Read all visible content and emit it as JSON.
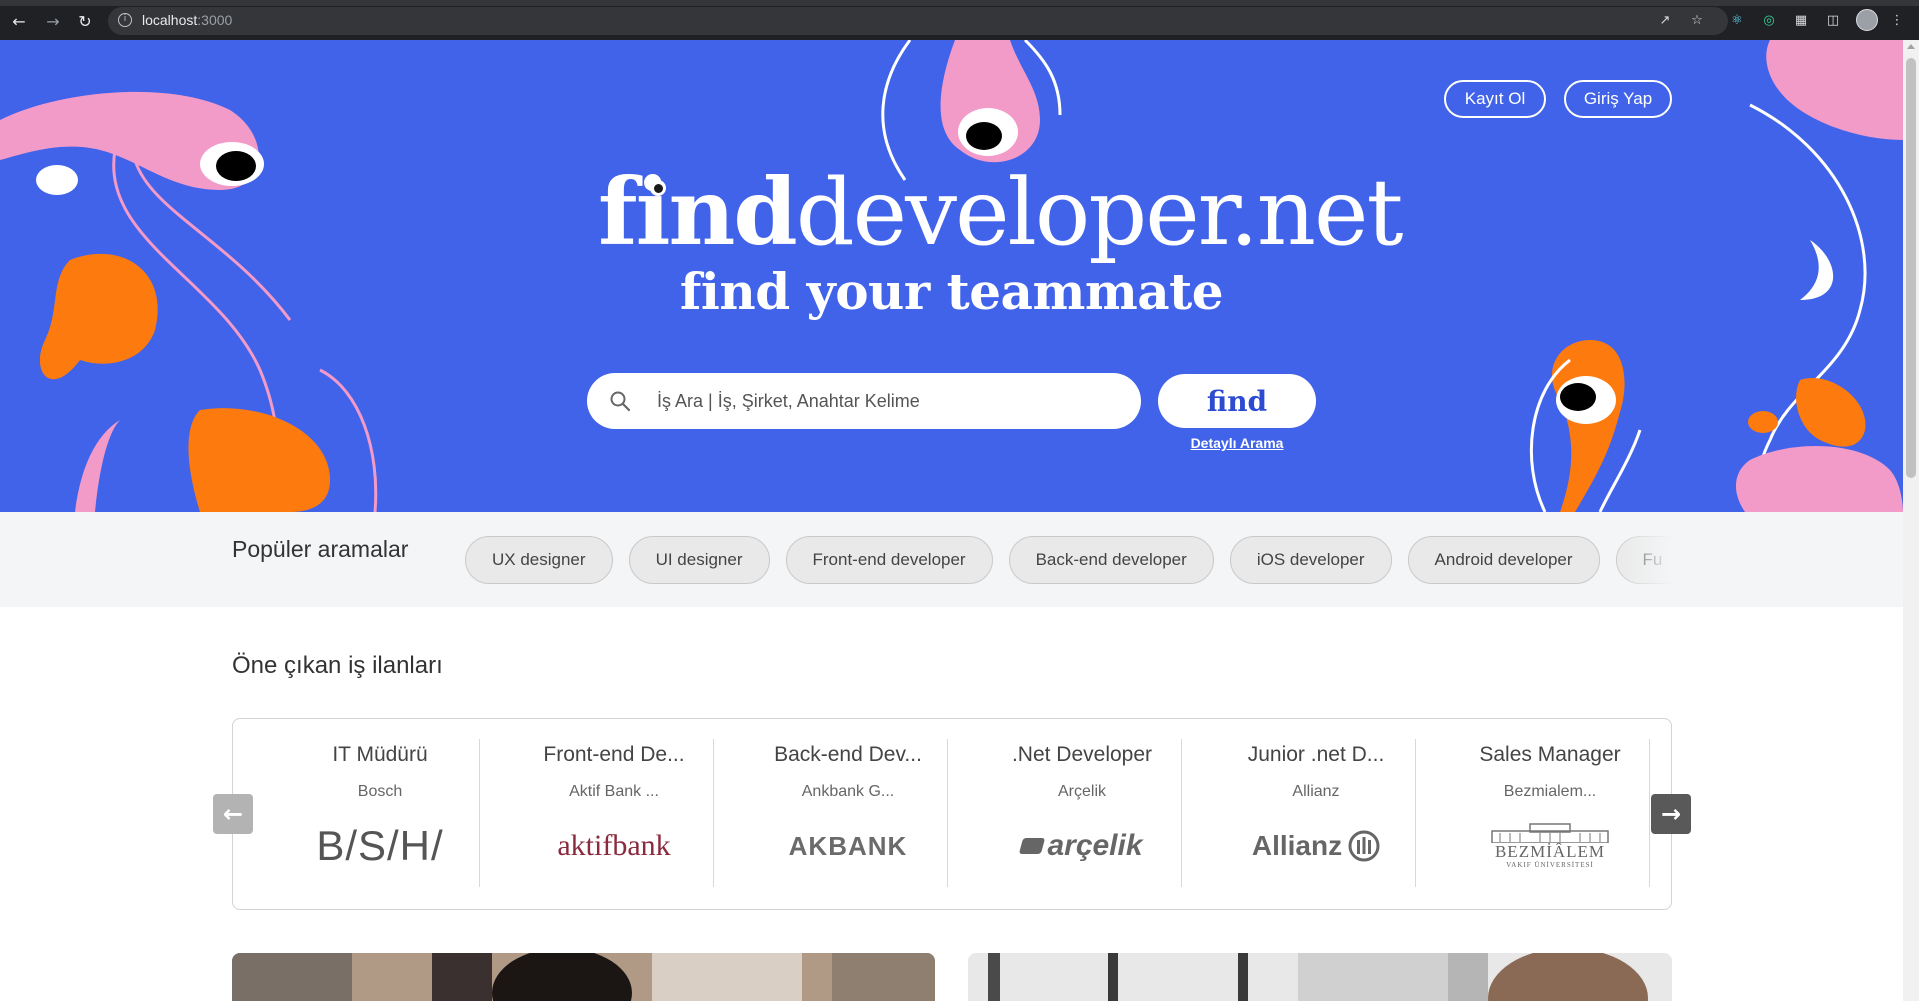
{
  "browser": {
    "url_host": "localhost",
    "url_port": ":3000"
  },
  "header": {
    "register_label": "Kayıt Ol",
    "login_label": "Giriş Yap"
  },
  "hero": {
    "logo_find": "find",
    "logo_rest": "developer.net",
    "tagline": "find your teammate",
    "search_placeholder": "İş Ara | İş, Şirket, Anahtar Kelime",
    "search_value": "",
    "find_button": "find",
    "detailed_search": "Detaylı Arama"
  },
  "popular": {
    "title": "Popüler aramalar",
    "chips": [
      {
        "label": "UX designer"
      },
      {
        "label": "UI designer"
      },
      {
        "label": "Front-end developer"
      },
      {
        "label": "Back-end developer"
      },
      {
        "label": "iOS developer"
      },
      {
        "label": "Android developer"
      },
      {
        "label": "Fu"
      }
    ]
  },
  "featured": {
    "title": "Öne çıkan iş ilanları",
    "jobs": [
      {
        "title": "IT Müdürü",
        "company": "Bosch",
        "logo_text": "B/S/H/"
      },
      {
        "title": "Front-end De...",
        "company": "Aktif Bank ...",
        "logo_text": "aktifbank"
      },
      {
        "title": "Back-end Dev...",
        "company": "Ankbank G...",
        "logo_text": "AKBANK"
      },
      {
        "title": ".Net Developer",
        "company": "Arçelik",
        "logo_text": "arçelik"
      },
      {
        "title": "Junior .net D...",
        "company": "Allianz",
        "logo_text": "Allianz"
      },
      {
        "title": "Sales Manager",
        "company": "Bezmialem...",
        "logo_text": "BEZMİÂLEM",
        "logo_subtext": "VAKIF ÜNİVERSİTESİ"
      }
    ]
  },
  "colors": {
    "hero_bg": "#4163e9",
    "pink": "#f29ac8",
    "orange": "#fd7a0f",
    "find_text": "#2d4bd0"
  }
}
